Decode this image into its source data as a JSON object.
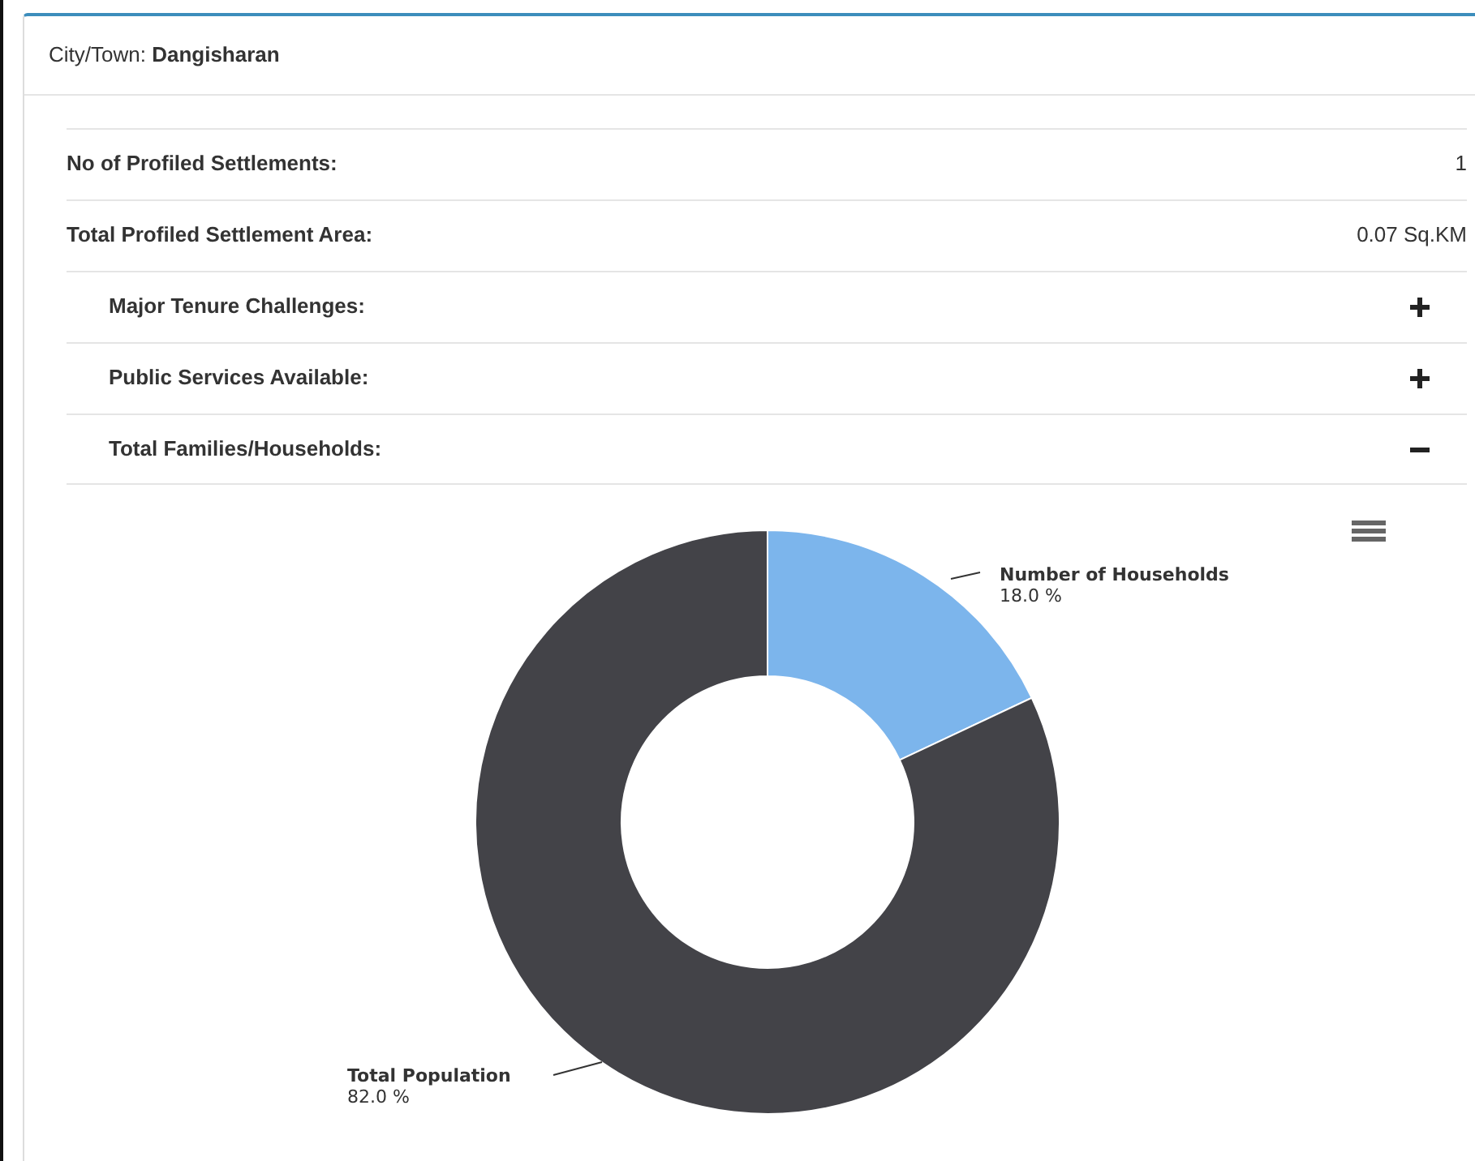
{
  "header": {
    "label": "City/Town:",
    "value": "Dangisharan"
  },
  "stats": [
    {
      "label": "No of Profiled Settlements:",
      "value": "1"
    },
    {
      "label": "Total Profiled Settlement Area:",
      "value": "0.07 Sq.KM"
    }
  ],
  "sections": [
    {
      "label": "Major Tenure Challenges:",
      "expanded": false
    },
    {
      "label": "Public Services Available:",
      "expanded": false
    },
    {
      "label": "Total Families/Households:",
      "expanded": true
    }
  ],
  "chart_data": {
    "type": "donut",
    "categories": [
      "Number of Households",
      "Total Population"
    ],
    "series": [
      {
        "colors": [
          "#7cb5ec",
          "#434348"
        ],
        "values": [
          18.0,
          82.0
        ]
      }
    ],
    "value_labels": [
      "18.0 %",
      "82.0 %"
    ]
  }
}
